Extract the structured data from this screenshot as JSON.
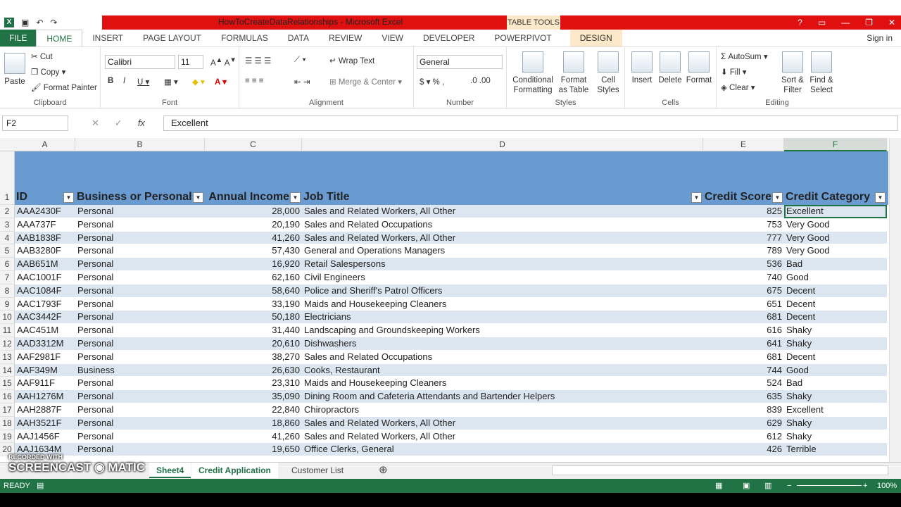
{
  "window": {
    "title": "HowToCreateDataRelationships - Microsoft Excel",
    "table_tools": "TABLE TOOLS",
    "help": "?",
    "signin": "Sign in"
  },
  "tabs": [
    "FILE",
    "HOME",
    "INSERT",
    "PAGE LAYOUT",
    "FORMULAS",
    "DATA",
    "REVIEW",
    "VIEW",
    "DEVELOPER",
    "POWERPIVOT",
    "DESIGN"
  ],
  "ribbon": {
    "clipboard": {
      "label": "Clipboard",
      "paste": "Paste",
      "cut": "Cut",
      "copy": "Copy",
      "format_painter": "Format Painter"
    },
    "font": {
      "label": "Font",
      "name": "Calibri",
      "size": "11"
    },
    "alignment": {
      "label": "Alignment",
      "wrap": "Wrap Text",
      "merge": "Merge & Center"
    },
    "number": {
      "label": "Number",
      "format": "General"
    },
    "styles": {
      "label": "Styles",
      "conditional": "Conditional Formatting",
      "format_table": "Format as Table",
      "cell_styles": "Cell Styles"
    },
    "cells": {
      "label": "Cells",
      "insert": "Insert",
      "delete": "Delete",
      "format": "Format"
    },
    "editing": {
      "label": "Editing",
      "autosum": "AutoSum",
      "fill": "Fill",
      "clear": "Clear",
      "sort": "Sort & Filter",
      "find": "Find & Select"
    }
  },
  "formula_bar": {
    "name_box": "F2",
    "value": "Excellent"
  },
  "columns": [
    "A",
    "B",
    "C",
    "D",
    "E",
    "F"
  ],
  "headers": [
    "ID",
    "Business or Personal",
    "Annual Income",
    "Job Title",
    "Credit Score",
    "Credit Category"
  ],
  "rows": [
    [
      "AAA2430F",
      "Personal",
      "28,000",
      "Sales and Related Workers, All Other",
      "825",
      "Excellent"
    ],
    [
      "AAA737F",
      "Personal",
      "20,190",
      "Sales and Related Occupations",
      "753",
      "Very Good"
    ],
    [
      "AAB1838F",
      "Personal",
      "41,260",
      "Sales and Related Workers, All Other",
      "777",
      "Very Good"
    ],
    [
      "AAB3280F",
      "Personal",
      "57,430",
      "General and Operations Managers",
      "789",
      "Very Good"
    ],
    [
      "AAB651M",
      "Personal",
      "16,920",
      "Retail Salespersons",
      "536",
      "Bad"
    ],
    [
      "AAC1001F",
      "Personal",
      "62,160",
      "Civil Engineers",
      "740",
      "Good"
    ],
    [
      "AAC1084F",
      "Personal",
      "58,640",
      "Police and Sheriff's Patrol Officers",
      "675",
      "Decent"
    ],
    [
      "AAC1793F",
      "Personal",
      "33,190",
      "Maids and Housekeeping Cleaners",
      "651",
      "Decent"
    ],
    [
      "AAC3442F",
      "Personal",
      "50,180",
      "Electricians",
      "681",
      "Decent"
    ],
    [
      "AAC451M",
      "Personal",
      "31,440",
      "Landscaping and Groundskeeping Workers",
      "616",
      "Shaky"
    ],
    [
      "AAD3312M",
      "Personal",
      "20,610",
      "Dishwashers",
      "641",
      "Shaky"
    ],
    [
      "AAF2981F",
      "Personal",
      "38,270",
      "Sales and Related Occupations",
      "681",
      "Decent"
    ],
    [
      "AAF349M",
      "Business",
      "26,630",
      "Cooks, Restaurant",
      "744",
      "Good"
    ],
    [
      "AAF911F",
      "Personal",
      "23,310",
      "Maids and Housekeeping Cleaners",
      "524",
      "Bad"
    ],
    [
      "AAH1276M",
      "Personal",
      "35,090",
      "Dining Room and Cafeteria Attendants and Bartender Helpers",
      "635",
      "Shaky"
    ],
    [
      "AAH2887F",
      "Personal",
      "22,840",
      "Chiropractors",
      "839",
      "Excellent"
    ],
    [
      "AAH3521F",
      "Personal",
      "18,860",
      "Sales and Related Workers, All Other",
      "629",
      "Shaky"
    ],
    [
      "AAJ1456F",
      "Personal",
      "41,260",
      "Sales and Related Workers, All Other",
      "612",
      "Shaky"
    ],
    [
      "AAJ1634M",
      "Personal",
      "19,650",
      "Office Clerks, General",
      "426",
      "Terrible"
    ]
  ],
  "sheet_tabs": [
    "Sheet4",
    "Credit Application",
    "Customer List"
  ],
  "status": {
    "ready": "READY",
    "zoom": "100%"
  },
  "watermark": {
    "line1": "RECORDED WITH",
    "line2": "SCREENCAST",
    "line3": "MATIC"
  }
}
